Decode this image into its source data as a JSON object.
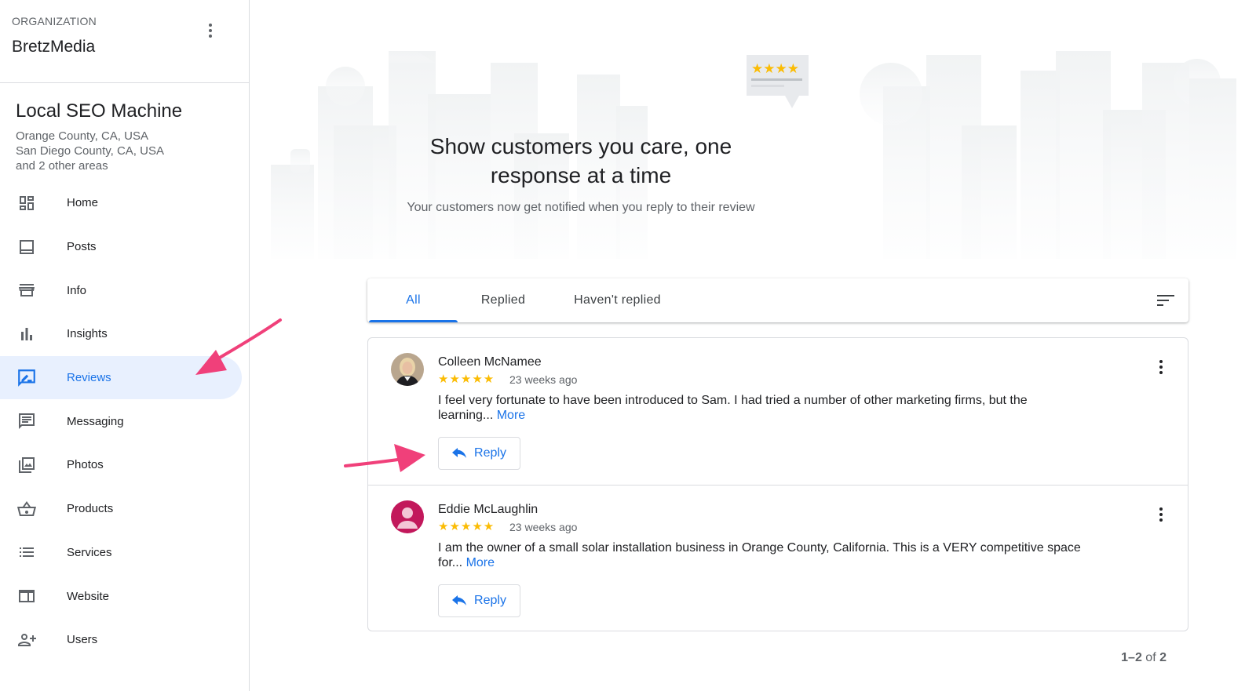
{
  "organization": {
    "label": "ORGANIZATION",
    "name": "BretzMedia"
  },
  "business": {
    "name": "Local SEO Machine",
    "areas": [
      "Orange County, CA, USA",
      "San Diego County, CA, USA",
      "and 2 other areas"
    ]
  },
  "nav": [
    {
      "label": "Home",
      "icon": "dashboard-icon"
    },
    {
      "label": "Posts",
      "icon": "posts-icon"
    },
    {
      "label": "Info",
      "icon": "storefront-icon"
    },
    {
      "label": "Insights",
      "icon": "bar-chart-icon"
    },
    {
      "label": "Reviews",
      "icon": "rate-review-icon",
      "active": true
    },
    {
      "label": "Messaging",
      "icon": "message-icon"
    },
    {
      "label": "Photos",
      "icon": "photos-icon"
    },
    {
      "label": "Products",
      "icon": "basket-icon"
    },
    {
      "label": "Services",
      "icon": "list-icon"
    },
    {
      "label": "Website",
      "icon": "website-icon"
    },
    {
      "label": "Users",
      "icon": "add-user-icon"
    }
  ],
  "hero": {
    "title": "Show customers you care, one response at a time",
    "subtitle": "Your customers now get notified when you reply to their review"
  },
  "tabs": [
    {
      "label": "All",
      "active": true
    },
    {
      "label": "Replied"
    },
    {
      "label": "Haven't replied"
    }
  ],
  "reviews": [
    {
      "name": "Colleen McNamee",
      "stars": "★★★★★",
      "rating": 5,
      "time": "23 weeks ago",
      "text": "I feel very fortunate to have been introduced to Sam. I had tried a number of other marketing firms, but the learning...",
      "more": "More",
      "reply": "Reply"
    },
    {
      "name": "Eddie McLaughlin",
      "stars": "★★★★★",
      "rating": 5,
      "time": "23 weeks ago",
      "text": "I am the owner of a small solar installation business in Orange County, California. This is a VERY competitive space for...",
      "more": "More",
      "reply": "Reply"
    }
  ],
  "pagination": {
    "range": "1–2",
    "of": "of",
    "total": "2"
  },
  "colors": {
    "accent": "#1a73e8",
    "star": "#fbbc04",
    "annotation_arrow": "#f0407a",
    "active_nav_bg": "#e8f0fe"
  }
}
